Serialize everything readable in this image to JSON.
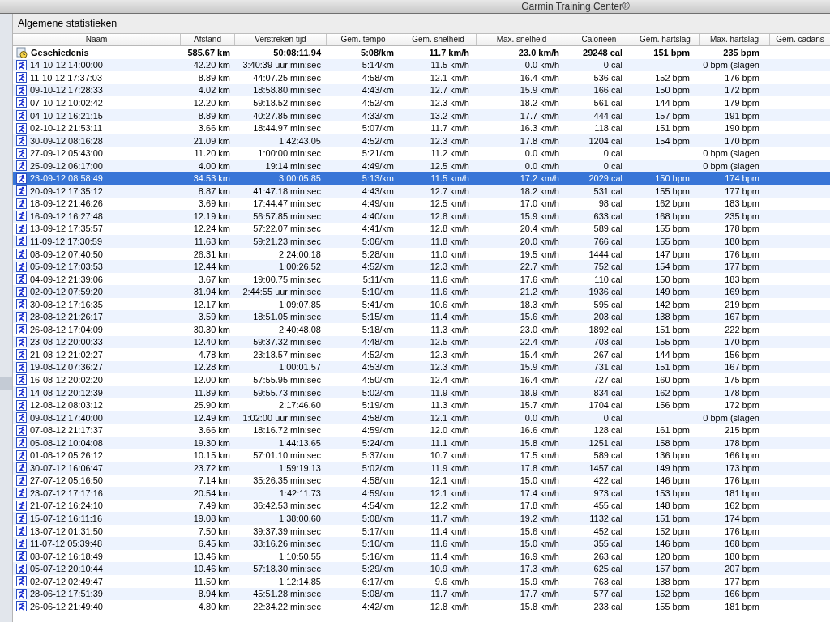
{
  "window": {
    "title": "Garmin Training Center®"
  },
  "panel": {
    "title": "Algemene statistieken"
  },
  "columns": [
    "Naam",
    "Afstand",
    "Verstreken tijd",
    "Gem. tempo",
    "Gem. snelheid",
    "Max. snelheid",
    "Calorieën",
    "Gem. hartslag",
    "Max. hartslag",
    "Gem. cadans"
  ],
  "summary": {
    "naam": "Geschiedenis",
    "afstand": "585.67 km",
    "tijd": "50:08:11.94",
    "tempo": "5:08/km",
    "snelheid": "11.7 km/h",
    "max_snelheid": "23.0 km/h",
    "calorieen": "29248 cal",
    "gem_hartslag": "151 bpm",
    "max_hartslag": "235 bpm"
  },
  "rows": [
    {
      "naam": "14-10-12 14:00:00",
      "afstand": "42.20 km",
      "tijd": "3:40:39 uur:min:sec",
      "tempo": "5:14/km",
      "snelheid": "11.5 km/h",
      "max_snelheid": "0.0 km/h",
      "calorieen": "0 cal",
      "max_hartslag": "0 bpm (slagen",
      "selected": false
    },
    {
      "naam": "11-10-12 17:37:03",
      "afstand": "8.89 km",
      "tijd": "44:07.25 min:sec",
      "tempo": "4:58/km",
      "snelheid": "12.1 km/h",
      "max_snelheid": "16.4 km/h",
      "calorieen": "536 cal",
      "gem_hartslag": "152 bpm",
      "max_hartslag": "176 bpm",
      "selected": false
    },
    {
      "naam": "09-10-12 17:28:33",
      "afstand": "4.02 km",
      "tijd": "18:58.80 min:sec",
      "tempo": "4:43/km",
      "snelheid": "12.7 km/h",
      "max_snelheid": "15.9 km/h",
      "calorieen": "166 cal",
      "gem_hartslag": "150 bpm",
      "max_hartslag": "172 bpm",
      "selected": false
    },
    {
      "naam": "07-10-12 10:02:42",
      "afstand": "12.20 km",
      "tijd": "59:18.52 min:sec",
      "tempo": "4:52/km",
      "snelheid": "12.3 km/h",
      "max_snelheid": "18.2 km/h",
      "calorieen": "561 cal",
      "gem_hartslag": "144 bpm",
      "max_hartslag": "179 bpm",
      "selected": false
    },
    {
      "naam": "04-10-12 16:21:15",
      "afstand": "8.89 km",
      "tijd": "40:27.85 min:sec",
      "tempo": "4:33/km",
      "snelheid": "13.2 km/h",
      "max_snelheid": "17.7 km/h",
      "calorieen": "444 cal",
      "gem_hartslag": "157 bpm",
      "max_hartslag": "191 bpm",
      "selected": false
    },
    {
      "naam": "02-10-12 21:53:11",
      "afstand": "3.66 km",
      "tijd": "18:44.97 min:sec",
      "tempo": "5:07/km",
      "snelheid": "11.7 km/h",
      "max_snelheid": "16.3 km/h",
      "calorieen": "118 cal",
      "gem_hartslag": "151 bpm",
      "max_hartslag": "190 bpm",
      "selected": false
    },
    {
      "naam": "30-09-12 08:16:28",
      "afstand": "21.09 km",
      "tijd": "1:42:43.05",
      "tempo": "4:52/km",
      "snelheid": "12.3 km/h",
      "max_snelheid": "17.8 km/h",
      "calorieen": "1204 cal",
      "gem_hartslag": "154 bpm",
      "max_hartslag": "170 bpm",
      "selected": false
    },
    {
      "naam": "27-09-12 05:43:00",
      "afstand": "11.20 km",
      "tijd": "1:00:00 min:sec",
      "tempo": "5:21/km",
      "snelheid": "11.2 km/h",
      "max_snelheid": "0.0 km/h",
      "calorieen": "0 cal",
      "max_hartslag": "0 bpm (slagen",
      "selected": false
    },
    {
      "naam": "25-09-12 06:17:00",
      "afstand": "4.00 km",
      "tijd": "19:14 min:sec",
      "tempo": "4:49/km",
      "snelheid": "12.5 km/h",
      "max_snelheid": "0.0 km/h",
      "calorieen": "0 cal",
      "max_hartslag": "0 bpm (slagen",
      "selected": false
    },
    {
      "naam": "23-09-12 08:58:49",
      "afstand": "34.53 km",
      "tijd": "3:00:05.85",
      "tempo": "5:13/km",
      "snelheid": "11.5 km/h",
      "max_snelheid": "17.2 km/h",
      "calorieen": "2029 cal",
      "gem_hartslag": "150 bpm",
      "max_hartslag": "174 bpm",
      "selected": true
    },
    {
      "naam": "20-09-12 17:35:12",
      "afstand": "8.87 km",
      "tijd": "41:47.18 min:sec",
      "tempo": "4:43/km",
      "snelheid": "12.7 km/h",
      "max_snelheid": "18.2 km/h",
      "calorieen": "531 cal",
      "gem_hartslag": "155 bpm",
      "max_hartslag": "177 bpm",
      "selected": false
    },
    {
      "naam": "18-09-12 21:46:26",
      "afstand": "3.69 km",
      "tijd": "17:44.47 min:sec",
      "tempo": "4:49/km",
      "snelheid": "12.5 km/h",
      "max_snelheid": "17.0 km/h",
      "calorieen": "98 cal",
      "gem_hartslag": "162 bpm",
      "max_hartslag": "183 bpm",
      "selected": false
    },
    {
      "naam": "16-09-12 16:27:48",
      "afstand": "12.19 km",
      "tijd": "56:57.85 min:sec",
      "tempo": "4:40/km",
      "snelheid": "12.8 km/h",
      "max_snelheid": "15.9 km/h",
      "calorieen": "633 cal",
      "gem_hartslag": "168 bpm",
      "max_hartslag": "235 bpm",
      "selected": false
    },
    {
      "naam": "13-09-12 17:35:57",
      "afstand": "12.24 km",
      "tijd": "57:22.07 min:sec",
      "tempo": "4:41/km",
      "snelheid": "12.8 km/h",
      "max_snelheid": "20.4 km/h",
      "calorieen": "589 cal",
      "gem_hartslag": "155 bpm",
      "max_hartslag": "178 bpm",
      "selected": false
    },
    {
      "naam": "11-09-12 17:30:59",
      "afstand": "11.63 km",
      "tijd": "59:21.23 min:sec",
      "tempo": "5:06/km",
      "snelheid": "11.8 km/h",
      "max_snelheid": "20.0 km/h",
      "calorieen": "766 cal",
      "gem_hartslag": "155 bpm",
      "max_hartslag": "180 bpm",
      "selected": false
    },
    {
      "naam": "08-09-12 07:40:50",
      "afstand": "26.31 km",
      "tijd": "2:24:00.18",
      "tempo": "5:28/km",
      "snelheid": "11.0 km/h",
      "max_snelheid": "19.5 km/h",
      "calorieen": "1444 cal",
      "gem_hartslag": "147 bpm",
      "max_hartslag": "176 bpm",
      "selected": false
    },
    {
      "naam": "05-09-12 17:03:53",
      "afstand": "12.44 km",
      "tijd": "1:00:26.52",
      "tempo": "4:52/km",
      "snelheid": "12.3 km/h",
      "max_snelheid": "22.7 km/h",
      "calorieen": "752 cal",
      "gem_hartslag": "154 bpm",
      "max_hartslag": "177 bpm",
      "selected": false
    },
    {
      "naam": "04-09-12 21:39:06",
      "afstand": "3.67 km",
      "tijd": "19:00.75 min:sec",
      "tempo": "5:11/km",
      "snelheid": "11.6 km/h",
      "max_snelheid": "17.6 km/h",
      "calorieen": "110 cal",
      "gem_hartslag": "150 bpm",
      "max_hartslag": "183 bpm",
      "selected": false
    },
    {
      "naam": "02-09-12 07:59:20",
      "afstand": "31.94 km",
      "tijd": "2:44:55 uur:min:sec",
      "tempo": "5:10/km",
      "snelheid": "11.6 km/h",
      "max_snelheid": "21.2 km/h",
      "calorieen": "1936 cal",
      "gem_hartslag": "149 bpm",
      "max_hartslag": "169 bpm",
      "selected": false
    },
    {
      "naam": "30-08-12 17:16:35",
      "afstand": "12.17 km",
      "tijd": "1:09:07.85",
      "tempo": "5:41/km",
      "snelheid": "10.6 km/h",
      "max_snelheid": "18.3 km/h",
      "calorieen": "595 cal",
      "gem_hartslag": "142 bpm",
      "max_hartslag": "219 bpm",
      "selected": false
    },
    {
      "naam": "28-08-12 21:26:17",
      "afstand": "3.59 km",
      "tijd": "18:51.05 min:sec",
      "tempo": "5:15/km",
      "snelheid": "11.4 km/h",
      "max_snelheid": "15.6 km/h",
      "calorieen": "203 cal",
      "gem_hartslag": "138 bpm",
      "max_hartslag": "167 bpm",
      "selected": false
    },
    {
      "naam": "26-08-12 17:04:09",
      "afstand": "30.30 km",
      "tijd": "2:40:48.08",
      "tempo": "5:18/km",
      "snelheid": "11.3 km/h",
      "max_snelheid": "23.0 km/h",
      "calorieen": "1892 cal",
      "gem_hartslag": "151 bpm",
      "max_hartslag": "222 bpm",
      "selected": false
    },
    {
      "naam": "23-08-12 20:00:33",
      "afstand": "12.40 km",
      "tijd": "59:37.32 min:sec",
      "tempo": "4:48/km",
      "snelheid": "12.5 km/h",
      "max_snelheid": "22.4 km/h",
      "calorieen": "703 cal",
      "gem_hartslag": "155 bpm",
      "max_hartslag": "170 bpm",
      "selected": false
    },
    {
      "naam": "21-08-12 21:02:27",
      "afstand": "4.78 km",
      "tijd": "23:18.57 min:sec",
      "tempo": "4:52/km",
      "snelheid": "12.3 km/h",
      "max_snelheid": "15.4 km/h",
      "calorieen": "267 cal",
      "gem_hartslag": "144 bpm",
      "max_hartslag": "156 bpm",
      "selected": false
    },
    {
      "naam": "19-08-12 07:36:27",
      "afstand": "12.28 km",
      "tijd": "1:00:01.57",
      "tempo": "4:53/km",
      "snelheid": "12.3 km/h",
      "max_snelheid": "15.9 km/h",
      "calorieen": "731 cal",
      "gem_hartslag": "151 bpm",
      "max_hartslag": "167 bpm",
      "selected": false
    },
    {
      "naam": "16-08-12 20:02:20",
      "afstand": "12.00 km",
      "tijd": "57:55.95 min:sec",
      "tempo": "4:50/km",
      "snelheid": "12.4 km/h",
      "max_snelheid": "16.4 km/h",
      "calorieen": "727 cal",
      "gem_hartslag": "160 bpm",
      "max_hartslag": "175 bpm",
      "selected": false
    },
    {
      "naam": "14-08-12 20:12:39",
      "afstand": "11.89 km",
      "tijd": "59:55.73 min:sec",
      "tempo": "5:02/km",
      "snelheid": "11.9 km/h",
      "max_snelheid": "18.9 km/h",
      "calorieen": "834 cal",
      "gem_hartslag": "162 bpm",
      "max_hartslag": "178 bpm",
      "selected": false
    },
    {
      "naam": "12-08-12 08:03:12",
      "afstand": "25.90 km",
      "tijd": "2:17:46.60",
      "tempo": "5:19/km",
      "snelheid": "11.3 km/h",
      "max_snelheid": "15.7 km/h",
      "calorieen": "1704 cal",
      "gem_hartslag": "156 bpm",
      "max_hartslag": "172 bpm",
      "selected": false
    },
    {
      "naam": "09-08-12 17:40:00",
      "afstand": "12.49 km",
      "tijd": "1:02:00 uur:min:sec",
      "tempo": "4:58/km",
      "snelheid": "12.1 km/h",
      "max_snelheid": "0.0 km/h",
      "calorieen": "0 cal",
      "max_hartslag": "0 bpm (slagen",
      "selected": false
    },
    {
      "naam": "07-08-12 21:17:37",
      "afstand": "3.66 km",
      "tijd": "18:16.72 min:sec",
      "tempo": "4:59/km",
      "snelheid": "12.0 km/h",
      "max_snelheid": "16.6 km/h",
      "calorieen": "128 cal",
      "gem_hartslag": "161 bpm",
      "max_hartslag": "215 bpm",
      "selected": false
    },
    {
      "naam": "05-08-12 10:04:08",
      "afstand": "19.30 km",
      "tijd": "1:44:13.65",
      "tempo": "5:24/km",
      "snelheid": "11.1 km/h",
      "max_snelheid": "15.8 km/h",
      "calorieen": "1251 cal",
      "gem_hartslag": "158 bpm",
      "max_hartslag": "178 bpm",
      "selected": false
    },
    {
      "naam": "01-08-12 05:26:12",
      "afstand": "10.15 km",
      "tijd": "57:01.10 min:sec",
      "tempo": "5:37/km",
      "snelheid": "10.7 km/h",
      "max_snelheid": "17.5 km/h",
      "calorieen": "589 cal",
      "gem_hartslag": "136 bpm",
      "max_hartslag": "166 bpm",
      "selected": false
    },
    {
      "naam": "30-07-12 16:06:47",
      "afstand": "23.72 km",
      "tijd": "1:59:19.13",
      "tempo": "5:02/km",
      "snelheid": "11.9 km/h",
      "max_snelheid": "17.8 km/h",
      "calorieen": "1457 cal",
      "gem_hartslag": "149 bpm",
      "max_hartslag": "173 bpm",
      "selected": false
    },
    {
      "naam": "27-07-12 05:16:50",
      "afstand": "7.14 km",
      "tijd": "35:26.35 min:sec",
      "tempo": "4:58/km",
      "snelheid": "12.1 km/h",
      "max_snelheid": "15.0 km/h",
      "calorieen": "422 cal",
      "gem_hartslag": "146 bpm",
      "max_hartslag": "176 bpm",
      "selected": false
    },
    {
      "naam": "23-07-12 17:17:16",
      "afstand": "20.54 km",
      "tijd": "1:42:11.73",
      "tempo": "4:59/km",
      "snelheid": "12.1 km/h",
      "max_snelheid": "17.4 km/h",
      "calorieen": "973 cal",
      "gem_hartslag": "153 bpm",
      "max_hartslag": "181 bpm",
      "selected": false
    },
    {
      "naam": "21-07-12 16:24:10",
      "afstand": "7.49 km",
      "tijd": "36:42.53 min:sec",
      "tempo": "4:54/km",
      "snelheid": "12.2 km/h",
      "max_snelheid": "17.8 km/h",
      "calorieen": "455 cal",
      "gem_hartslag": "148 bpm",
      "max_hartslag": "162 bpm",
      "selected": false
    },
    {
      "naam": "15-07-12 16:11:16",
      "afstand": "19.08 km",
      "tijd": "1:38:00.60",
      "tempo": "5:08/km",
      "snelheid": "11.7 km/h",
      "max_snelheid": "19.2 km/h",
      "calorieen": "1132 cal",
      "gem_hartslag": "151 bpm",
      "max_hartslag": "174 bpm",
      "selected": false
    },
    {
      "naam": "13-07-12 01:31:50",
      "afstand": "7.50 km",
      "tijd": "39:37.39 min:sec",
      "tempo": "5:17/km",
      "snelheid": "11.4 km/h",
      "max_snelheid": "15.6 km/h",
      "calorieen": "452 cal",
      "gem_hartslag": "152 bpm",
      "max_hartslag": "176 bpm",
      "selected": false
    },
    {
      "naam": "11-07-12 05:39:48",
      "afstand": "6.45 km",
      "tijd": "33:16.26 min:sec",
      "tempo": "5:10/km",
      "snelheid": "11.6 km/h",
      "max_snelheid": "15.0 km/h",
      "calorieen": "355 cal",
      "gem_hartslag": "146 bpm",
      "max_hartslag": "168 bpm",
      "selected": false
    },
    {
      "naam": "08-07-12 16:18:49",
      "afstand": "13.46 km",
      "tijd": "1:10:50.55",
      "tempo": "5:16/km",
      "snelheid": "11.4 km/h",
      "max_snelheid": "16.9 km/h",
      "calorieen": "263 cal",
      "gem_hartslag": "120 bpm",
      "max_hartslag": "180 bpm",
      "selected": false
    },
    {
      "naam": "05-07-12 20:10:44",
      "afstand": "10.46 km",
      "tijd": "57:18.30 min:sec",
      "tempo": "5:29/km",
      "snelheid": "10.9 km/h",
      "max_snelheid": "17.3 km/h",
      "calorieen": "625 cal",
      "gem_hartslag": "157 bpm",
      "max_hartslag": "207 bpm",
      "selected": false
    },
    {
      "naam": "02-07-12 02:49:47",
      "afstand": "11.50 km",
      "tijd": "1:12:14.85",
      "tempo": "6:17/km",
      "snelheid": "9.6 km/h",
      "max_snelheid": "15.9 km/h",
      "calorieen": "763 cal",
      "gem_hartslag": "138 bpm",
      "max_hartslag": "177 bpm",
      "selected": false
    },
    {
      "naam": "28-06-12 17:51:39",
      "afstand": "8.94 km",
      "tijd": "45:51.28 min:sec",
      "tempo": "5:08/km",
      "snelheid": "11.7 km/h",
      "max_snelheid": "17.7 km/h",
      "calorieen": "577 cal",
      "gem_hartslag": "152 bpm",
      "max_hartslag": "166 bpm",
      "selected": false
    },
    {
      "naam": "26-06-12 21:49:40",
      "afstand": "4.80 km",
      "tijd": "22:34.22 min:sec",
      "tempo": "4:42/km",
      "snelheid": "12.8 km/h",
      "max_snelheid": "15.8 km/h",
      "calorieen": "233 cal",
      "gem_hartslag": "155 bpm",
      "max_hartslag": "181 bpm",
      "selected": false
    }
  ]
}
